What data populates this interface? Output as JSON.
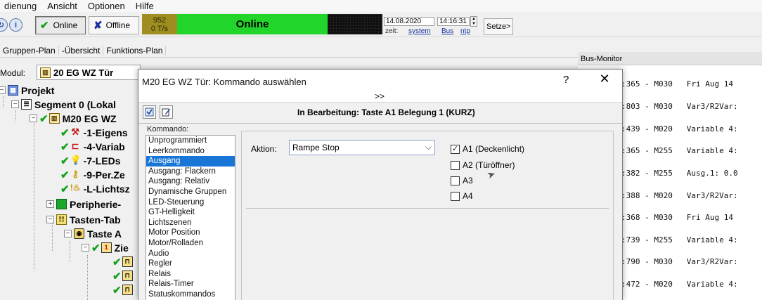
{
  "menu": [
    "dienung",
    "Ansicht",
    "Optionen",
    "Hilfe"
  ],
  "toolbar": {
    "online_btn": "Online",
    "offline_btn": "Offline",
    "counter_top": "952",
    "counter_bottom": "0 T/s",
    "online_status": "Online",
    "date": "14.08.2020",
    "time": "14:16:31",
    "zeit_label": "zeit:",
    "link_system": "system",
    "link_bus": "Bus",
    "link_ntp": "ntp",
    "setze_btn": "Setze>"
  },
  "tabs": [
    "Gruppen-Plan",
    "-Übersicht",
    "Funktions-Plan"
  ],
  "modul": {
    "label": "Modul:",
    "value": "20 EG WZ Tür"
  },
  "tree": [
    {
      "text": "Projekt",
      "level": 0
    },
    {
      "text": "Segment 0 (Lokal",
      "level": 1
    },
    {
      "text": "M20  EG WZ",
      "level": 2
    },
    {
      "text": "-1-Eigens",
      "level": 3
    },
    {
      "text": "-4-Variab",
      "level": 3
    },
    {
      "text": "-7-LEDs",
      "level": 3
    },
    {
      "text": "-9-Per.Ze",
      "level": 3
    },
    {
      "text": "-L-Lichtsz",
      "level": 3
    },
    {
      "text": "Peripherie-",
      "level": 3
    },
    {
      "text": "Tasten-Tab",
      "level": 3
    },
    {
      "text": "Taste A",
      "level": 4
    },
    {
      "text": "Zie",
      "level": 5
    }
  ],
  "busmonitor": {
    "title": "Bus-Monitor",
    "lines": [
      ":365 - M030   Fri Aug 14",
      ":803 - M030   Var3/R2Var:",
      ":439 - M020   Variable 4:",
      ":365 - M255   Variable 4:",
      ":382 - M255   Ausg.1: 0.0",
      ":388 - M020   Var3/R2Var:",
      ":368 - M030   Fri Aug 14",
      ":739 - M255   Variable 4:",
      ":790 - M030   Var3/R2Var:",
      ":472 - M020   Variable 4:"
    ]
  },
  "dialog": {
    "title": "M20 EG WZ Tür: Kommando auswählen",
    "help": "?",
    "close": "✕",
    "chevron": ">>",
    "edit_title": "In Bearbeitung: Taste A1 Belegung 1 (KURZ)",
    "kommando_label": "Kommando:",
    "kommandos": [
      "Unprogrammiert",
      "Leerkommando",
      "Ausgang",
      "Ausgang: Flackern",
      "Ausgang: Relativ",
      "Dynamische Gruppen",
      "LED-Steuerung",
      "GT-Helligkeit",
      "Lichtszenen",
      "Motor Position",
      "Motor/Rolladen",
      "Audio",
      "Regler",
      "Relais",
      "Relais-Timer",
      "Statuskommandos"
    ],
    "selected_kommando": "Ausgang",
    "aktion_label": "Aktion:",
    "aktion_value": "Rampe Stop",
    "outputs": [
      {
        "label": "A1 (Deckenlicht)",
        "checked": true
      },
      {
        "label": "A2 (Türöffner)",
        "checked": false
      },
      {
        "label": "A3",
        "checked": false
      },
      {
        "label": "A4",
        "checked": false
      }
    ]
  },
  "colors": {
    "online_green": "#22d52a",
    "counter_bg": "#a08d21",
    "selection_blue": "#1976d7"
  }
}
